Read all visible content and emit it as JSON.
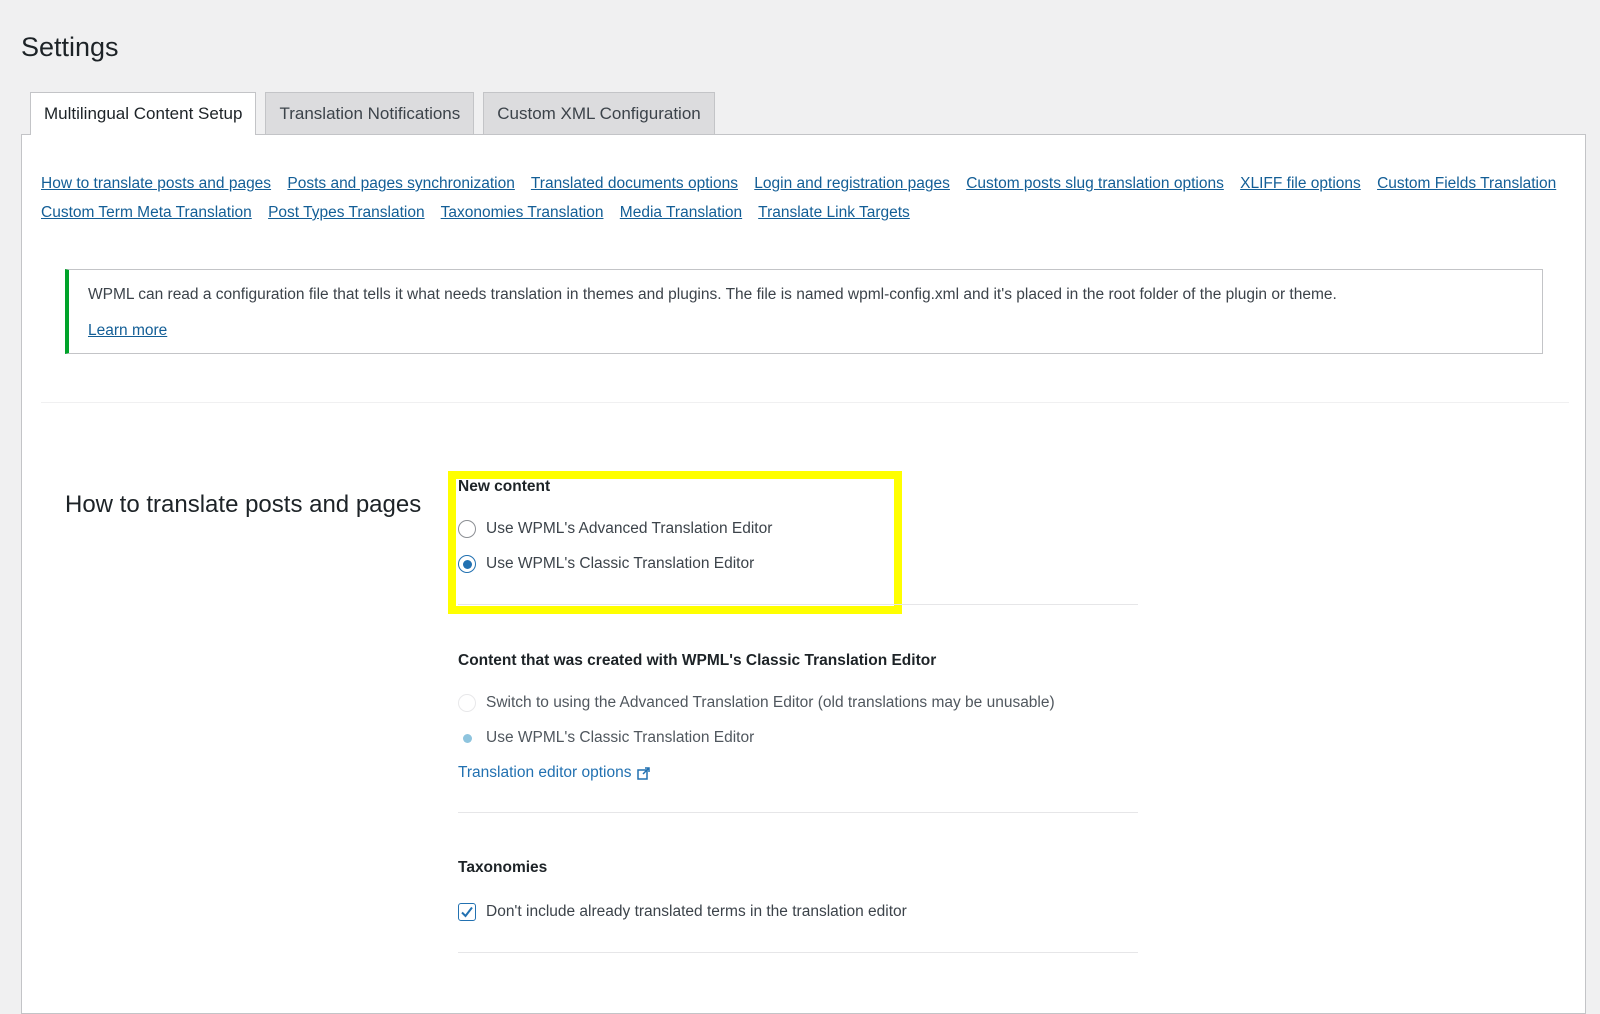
{
  "page": {
    "title": "Settings"
  },
  "tabs": [
    {
      "label": "Multilingual Content Setup",
      "active": true
    },
    {
      "label": "Translation Notifications",
      "active": false
    },
    {
      "label": "Custom XML Configuration",
      "active": false
    }
  ],
  "quick_links": [
    "How to translate posts and pages",
    "Posts and pages synchronization",
    "Translated documents options",
    "Login and registration pages",
    "Custom posts slug translation options",
    "XLIFF file options",
    "Custom Fields Translation",
    "Custom Term Meta Translation",
    "Post Types Translation",
    "Taxonomies Translation",
    "Media Translation",
    "Translate Link Targets"
  ],
  "notice": {
    "text": "WPML can read a configuration file that tells it what needs translation in themes and plugins. The file is named wpml-config.xml and it's placed in the root folder of the plugin or theme.",
    "link": "Learn more",
    "accent_color": "#00a32a"
  },
  "section": {
    "title": "How to translate posts and pages",
    "new_content": {
      "heading": "New content",
      "options": [
        {
          "label": "Use WPML's Advanced Translation Editor",
          "checked": false
        },
        {
          "label": "Use WPML's Classic Translation Editor",
          "checked": true
        }
      ]
    },
    "existing_content": {
      "heading": "Content that was created with WPML's Classic Translation Editor",
      "options": [
        {
          "label": "Switch to using the Advanced Translation Editor (old translations may be unusable)",
          "checked": false
        },
        {
          "label": "Use WPML's Classic Translation Editor",
          "checked": true
        }
      ],
      "link": "Translation editor options"
    },
    "taxonomies": {
      "heading": "Taxonomies",
      "checkbox_label": "Don't include already translated terms in the translation editor",
      "checked": true
    }
  },
  "colors": {
    "highlight": "#ffff00",
    "link": "#2271b1"
  }
}
